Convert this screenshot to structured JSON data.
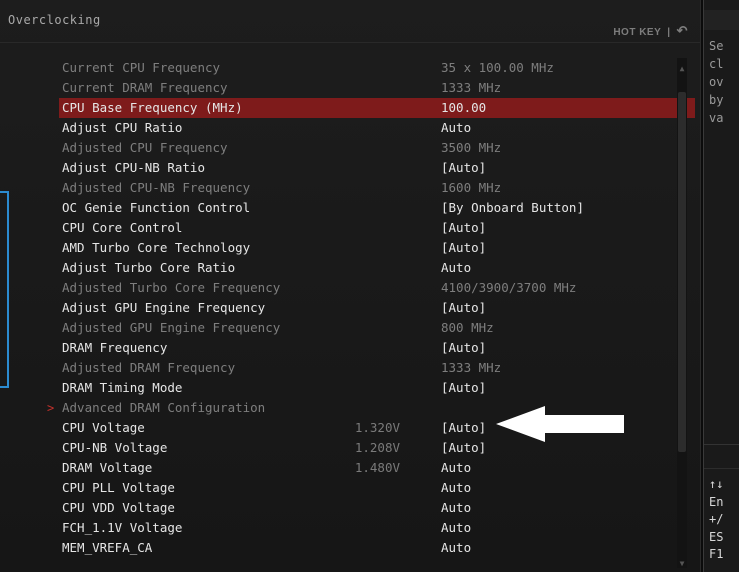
{
  "header": {
    "title": "Overclocking",
    "hotkey_label": "HOT KEY",
    "separator": "|",
    "undo_icon": "↶"
  },
  "settings": [
    {
      "label": "Current CPU Frequency",
      "value": "35 x 100.00 MHz",
      "dim": true
    },
    {
      "label": "Current DRAM Frequency",
      "value": "1333 MHz",
      "dim": true
    },
    {
      "label": "CPU Base Frequency (MHz)",
      "value": "100.00",
      "selected": true
    },
    {
      "label": "Adjust CPU Ratio",
      "value": "Auto"
    },
    {
      "label": "Adjusted CPU Frequency",
      "value": "3500 MHz",
      "dim": true
    },
    {
      "label": "Adjust CPU-NB Ratio",
      "value": "[Auto]"
    },
    {
      "label": "Adjusted CPU-NB Frequency",
      "value": "1600 MHz",
      "dim": true
    },
    {
      "label": "OC Genie Function Control",
      "value": "[By Onboard Button]"
    },
    {
      "label": "CPU Core Control",
      "value": "[Auto]"
    },
    {
      "label": "AMD Turbo Core Technology",
      "value": "[Auto]"
    },
    {
      "label": "Adjust Turbo Core Ratio",
      "value": "Auto"
    },
    {
      "label": "Adjusted Turbo Core Frequency",
      "value": "4100/3900/3700 MHz",
      "dim": true
    },
    {
      "label": "Adjust GPU Engine Frequency",
      "value": "[Auto]"
    },
    {
      "label": "Adjusted GPU Engine Frequency",
      "value": "800 MHz",
      "dim": true
    },
    {
      "label": "DRAM Frequency",
      "value": "[Auto]"
    },
    {
      "label": "Adjusted DRAM Frequency",
      "value": "1333 MHz",
      "dim": true
    },
    {
      "label": "DRAM Timing Mode",
      "value": "[Auto]"
    },
    {
      "label": "Advanced DRAM Configuration",
      "value": "",
      "dim": true,
      "submenu": true,
      "marker": ">"
    },
    {
      "label": "CPU Voltage",
      "voltage": "1.320V",
      "value": "[Auto]"
    },
    {
      "label": "CPU-NB Voltage",
      "voltage": "1.208V",
      "value": "[Auto]"
    },
    {
      "label": "DRAM Voltage",
      "voltage": "1.480V",
      "value": "Auto"
    },
    {
      "label": "CPU PLL Voltage",
      "value": "Auto"
    },
    {
      "label": "CPU VDD Voltage",
      "value": "Auto"
    },
    {
      "label": "FCH_1.1V Voltage",
      "value": "Auto"
    },
    {
      "label": "MEM_VREFA_CA",
      "value": "Auto"
    }
  ],
  "scrollbar": {
    "up_icon": "▲",
    "down_icon": "▼"
  },
  "help_panel": {
    "text_lines": [
      "Se",
      "cl",
      "ov",
      "by",
      "va"
    ],
    "key_lines": [
      "↑↓",
      "En",
      "+/",
      "ES",
      "F1"
    ]
  },
  "colors": {
    "selected_row": "#7e1b1b",
    "bracket": "#2b8bd0",
    "arrow": "#ffffff"
  }
}
